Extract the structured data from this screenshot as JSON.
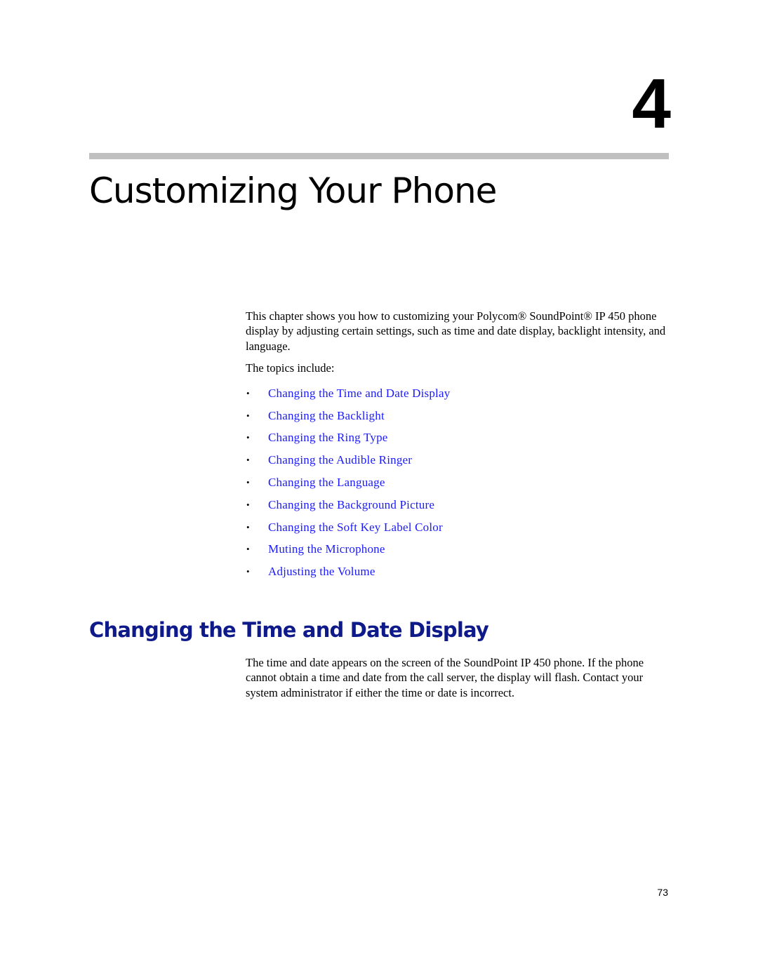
{
  "chapter": {
    "number": "4",
    "title": "Customizing Your Phone"
  },
  "intro": {
    "paragraph": "This chapter shows you how to customizing your Polycom® SoundPoint® IP 450 phone display by adjusting certain settings, such as time and date display, backlight intensity, and language.",
    "topics_lead": "The topics include:",
    "bullet_glyph": "•",
    "topics": [
      "Changing the Time and Date Display",
      "Changing the Backlight",
      "Changing the Ring Type",
      "Changing the Audible Ringer",
      "Changing the Language",
      "Changing the Background Picture",
      "Changing the Soft Key Label Color",
      "Muting the Microphone",
      "Adjusting the Volume"
    ]
  },
  "section": {
    "title": "Changing the Time and Date Display",
    "paragraph": "The time and date appears on the screen of the SoundPoint IP 450 phone. If the phone cannot obtain a time and date from the call server, the display will flash. Contact your system administrator if either the time or date is incorrect."
  },
  "footer": {
    "page_number": "73"
  },
  "colors": {
    "link": "#1a1aff",
    "section_heading": "#0f1a8a",
    "rule": "#c0c0c0"
  }
}
